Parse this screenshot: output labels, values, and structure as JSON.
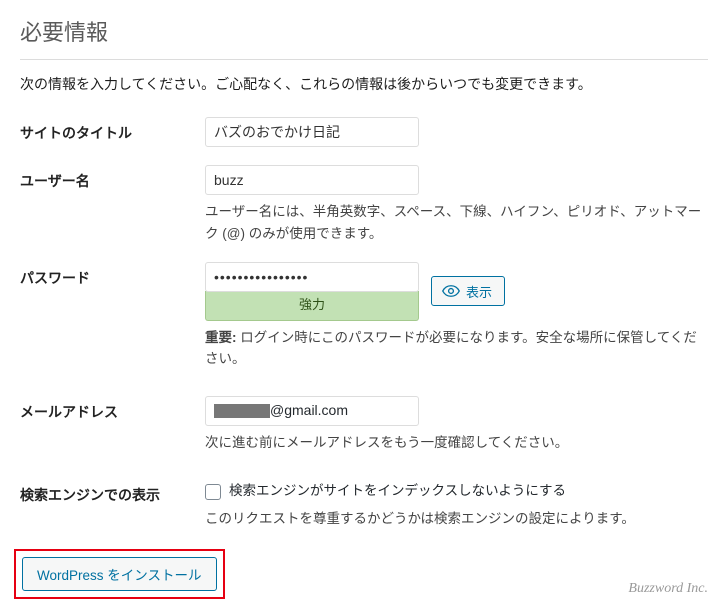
{
  "heading": "必要情報",
  "intro": "次の情報を入力してください。ご心配なく、これらの情報は後からいつでも変更できます。",
  "fields": {
    "site_title": {
      "label": "サイトのタイトル",
      "value": "バズのおでかけ日記"
    },
    "username": {
      "label": "ユーザー名",
      "value": "buzz",
      "hint": "ユーザー名には、半角英数字、スペース、下線、ハイフン、ピリオド、アットマーク (@) のみが使用できます。"
    },
    "password": {
      "label": "パスワード",
      "value": "••••••••••••••••",
      "show_button": "表示",
      "strength": "強力",
      "hint_strong": "重要:",
      "hint": "ログイン時にこのパスワードが必要になります。安全な場所に保管してください。"
    },
    "email": {
      "label": "メールアドレス",
      "value_suffix": "@gmail.com",
      "hint": "次に進む前にメールアドレスをもう一度確認してください。"
    },
    "search_engine": {
      "label": "検索エンジンでの表示",
      "checkbox_label": "検索エンジンがサイトをインデックスしないようにする",
      "hint": "このリクエストを尊重するかどうかは検索エンジンの設定によります。"
    }
  },
  "install_button": "WordPress をインストール",
  "footer_brand": "Buzzword Inc."
}
